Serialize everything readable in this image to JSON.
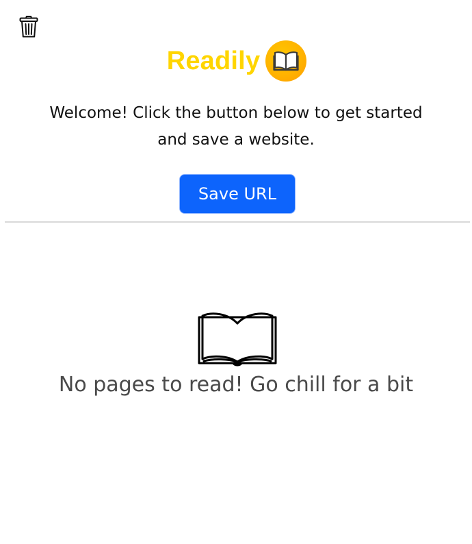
{
  "header": {
    "delete_icon": "trash-icon",
    "brand_name": "Readily",
    "brand_logo_icon": "open-book-icon",
    "brand_color": "#ffd500",
    "logo_color": "#ffb300"
  },
  "welcome": {
    "message": "Welcome! Click the button below to get started and save a website."
  },
  "actions": {
    "save_label": "Save URL",
    "save_color": "#0d64fc"
  },
  "empty_state": {
    "icon": "open-book-outline-icon",
    "message": "No pages to read! Go chill for a bit"
  }
}
